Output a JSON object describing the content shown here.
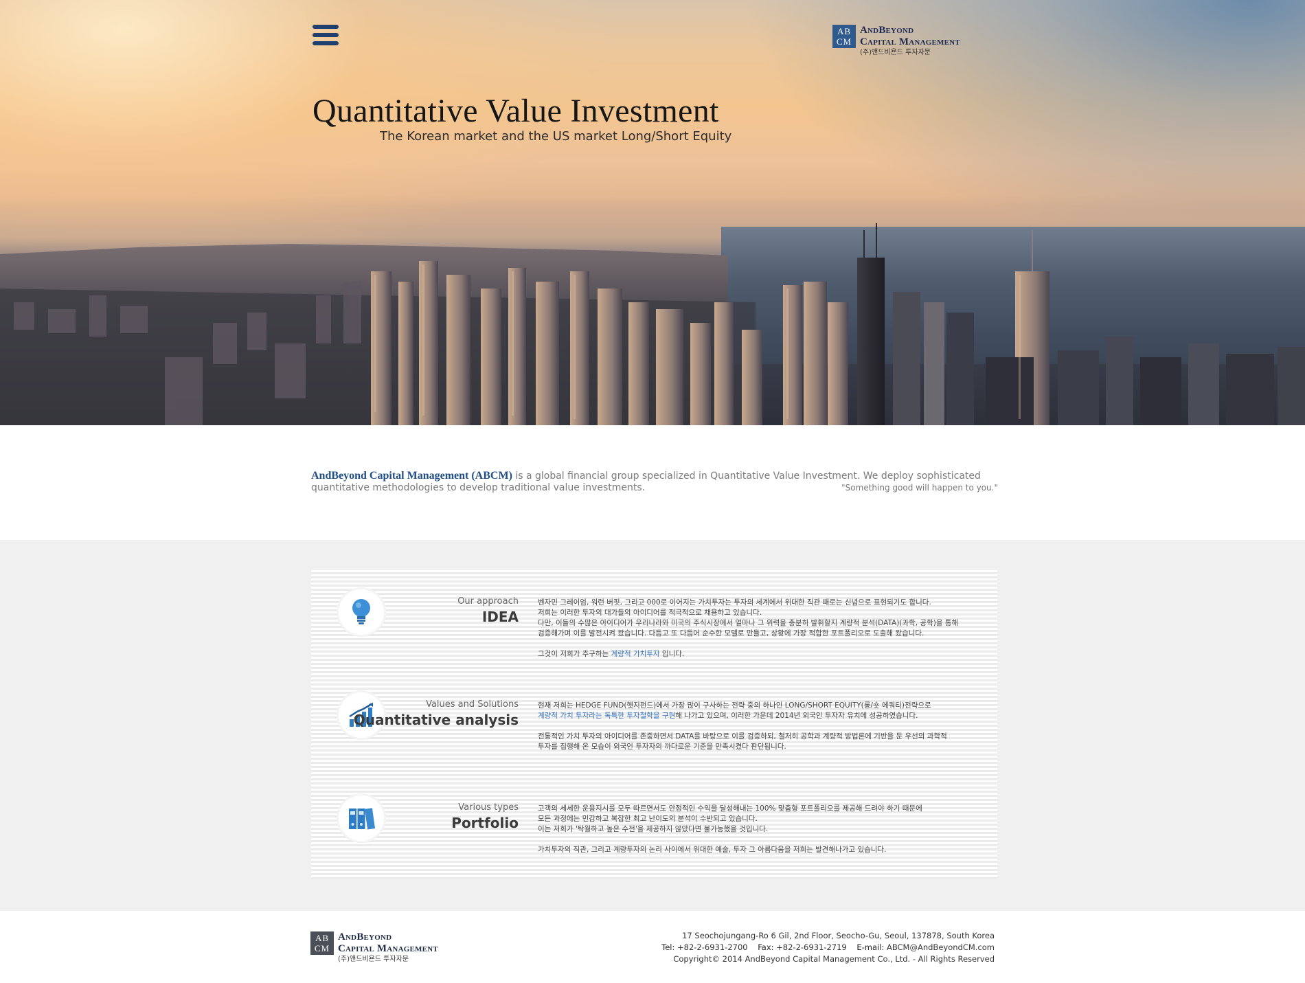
{
  "brand": {
    "mark_top": "AB",
    "mark_bottom": "CM",
    "line1": "AndBeyond",
    "line2": "Capital Management",
    "korean": "(주)앤드비욘드 투자자문"
  },
  "hero": {
    "title": "Quantitative Value Investment",
    "subtitle": "The Korean market and the US market Long/Short Equity"
  },
  "intro": {
    "brand_name": "AndBeyond Capital Management (ABCM)",
    "text": " is a global financial group specialized in Quantitative Value Investment. We deploy sophisticated quantitative methodologies to develop traditional value investments.",
    "quote": "\"Something good will happen to you.\""
  },
  "services": [
    {
      "kicker": "Our approach",
      "heading": "IDEA",
      "icon": "lightbulb-icon",
      "lines": [
        "벤자민 그레이엄, 워런 버핏, 그리고 000로 이어지는 가치투자는 투자의 세계에서 위대한 직관 때로는 신념으로 표현되기도 합니다.",
        "저희는 이러한 투자의 대가들의 아이디어를 적극적으로 채용하고 있습니다.",
        "다만, 이들의 수많은 아이디어가 우리나라와 미국의 주식시장에서 얼마나 그 위력을 충분히 발휘할지 계량적 분석(DATA)(과학, 공학)을 통해",
        "검증해가며 이를 발전시켜 왔습니다. 다듬고 또 다듬어 순수한 모델로 만들고, 상황에 가장 적합한 포트폴리오로 도출해 왔습니다."
      ],
      "closing_pre": "그것이 저희가 추구하는 ",
      "closing_hl": "계량적 가치투자",
      "closing_post": " 입니다."
    },
    {
      "kicker": "Values and Solutions",
      "heading": "Quantitative analysis",
      "icon": "bar-chart-icon",
      "line1": "현재 저희는 HEDGE FUND(헷지펀드)에서 가장 많이 구사하는 전략 중의 하나인 LONG/SHORT EQUITY(롱/숏 에쿼티)전략으로",
      "line2_hl": "계량적 가치 투자라는 독특한 투자철학을 구현",
      "line2_post": "해 나가고 있으며, 이러한 가운데 2014년 외국인 투자자 유치에 성공하였습니다.",
      "line3": "전통적인 가치 투자의 아이디어를 존중하면서 DATA를 바탕으로 이를 검증하되, 철저히 공학과 계량적 방법론에 기반을 둔 우선의 과학적",
      "line4": "투자를 집행해 온 모습이 외국인 투자자의 까다로운 기준을 만족시켰다 판단됩니다."
    },
    {
      "kicker": "Various types",
      "heading": "Portfolio",
      "icon": "binders-icon",
      "lines": [
        "고객의 세세한 운용지시를 모두 따르면서도 안정적인 수익을 달성해내는 100% 맞춤형 포트폴리오를 제공해 드려야 하기 때문에",
        "모든 과정에는 민감하고 복잡한 최고 난이도의 분석이 수반되고 있습니다.",
        "이는 저희가 '탁월하고 높은 수전'을 제공하지 않았다면 불가능했을 것입니다."
      ],
      "closing": "가치투자의 직관, 그리고 계량투자의 논리 사이에서 위대한 예술, 투자 그 아름다움을 저희는 발견해나가고 있습니다."
    }
  ],
  "footer": {
    "address": "17 Seochojungang-Ro 6 Gil, 2nd Floor, Seocho-Gu, Seoul, 137878, South Korea",
    "tel_label": "Tel:",
    "tel": "+82-2-6931-2700",
    "fax_label": "Fax:",
    "fax": "+82-2-6931-2719",
    "email_label": "E-mail:",
    "email": "ABCM@AndBeyondCM.com",
    "copyright": "Copyright© 2014 AndBeyond Capital Management Co., Ltd. - All Rights Reserved"
  },
  "colors": {
    "brand_blue": "#1f4f86",
    "highlight_blue": "#2f6cb8",
    "band_gray": "#f0f0f0"
  }
}
